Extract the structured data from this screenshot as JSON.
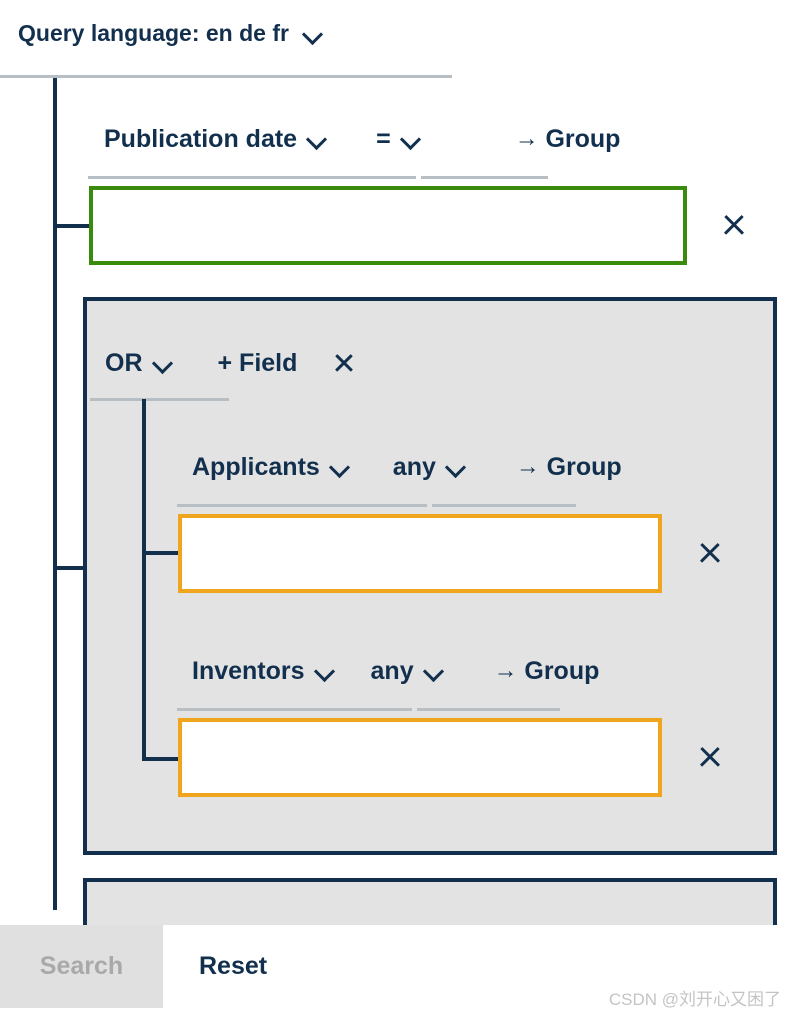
{
  "header": {
    "query_language_label": "Query language: en de fr",
    "dropdown_icon": "chevron-down-icon"
  },
  "top_field": {
    "field_name": "Publication date",
    "field_dropdown_icon": "chevron-down-icon",
    "operator": "=",
    "operator_dropdown_icon": "chevron-down-icon",
    "group_link": "Group",
    "group_arrow": "→",
    "value": "",
    "placeholder": "",
    "remove_icon": "close-icon",
    "border_color": "#3a8a0e"
  },
  "group": {
    "operator": "OR",
    "operator_dropdown_icon": "chevron-down-icon",
    "add_field_label": "+ Field",
    "remove_icon": "close-icon",
    "background_color": "#e3e3e3",
    "border_color": "#12304d",
    "fields": [
      {
        "field_name": "Applicants",
        "field_dropdown_icon": "chevron-down-icon",
        "operator": "any",
        "operator_dropdown_icon": "chevron-down-icon",
        "group_link": "Group",
        "group_arrow": "→",
        "value": "",
        "placeholder": "",
        "remove_icon": "close-icon",
        "border_color": "#f0a51e"
      },
      {
        "field_name": "Inventors",
        "field_dropdown_icon": "chevron-down-icon",
        "operator": "any",
        "operator_dropdown_icon": "chevron-down-icon",
        "group_link": "Group",
        "group_arrow": "→",
        "value": "",
        "placeholder": "",
        "remove_icon": "close-icon",
        "border_color": "#f0a51e"
      }
    ]
  },
  "second_group": {
    "background_color": "#e3e3e3",
    "border_color": "#12304d"
  },
  "actions": {
    "search_label": "Search",
    "search_disabled": true,
    "reset_label": "Reset"
  },
  "watermark": {
    "text": "CSDN @刘开心又困了"
  }
}
